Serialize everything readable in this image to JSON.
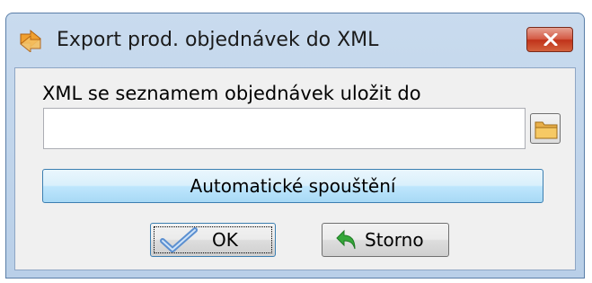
{
  "window": {
    "title": "Export prod. objednávek do XML",
    "icon": "export-arrows-icon"
  },
  "form": {
    "path_label": "XML se seznamem objednávek uložit do",
    "path_value": "",
    "browse_icon": "folder-icon"
  },
  "buttons": {
    "auto_label": "Automatické spouštění",
    "ok_label": "OK",
    "cancel_label": "Storno"
  },
  "colors": {
    "title_bar": "#c9dbee",
    "close_button": "#c9432d",
    "auto_button": "#bee6fd",
    "client_bg": "#f0f0f0"
  }
}
